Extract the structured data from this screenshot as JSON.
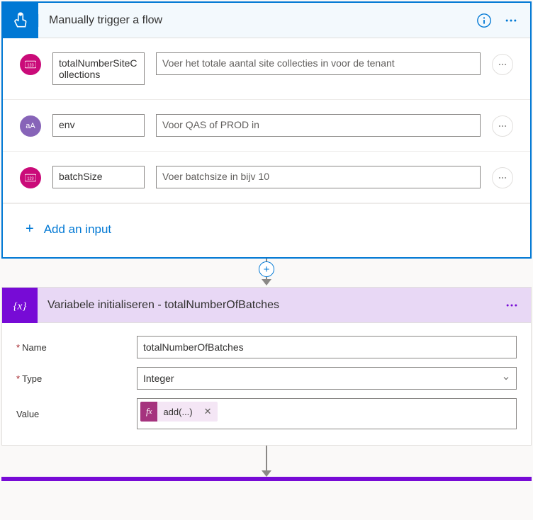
{
  "trigger": {
    "title": "Manually trigger a flow",
    "inputs": [
      {
        "type": "number",
        "name": "totalNumberSiteCollections",
        "desc": "Voer het totale aantal site collecties in voor de tenant"
      },
      {
        "type": "text",
        "name": "env",
        "desc": "Voor QAS of PROD in"
      },
      {
        "type": "number",
        "name": "batchSize",
        "desc": "Voer batchsize in bijv 10"
      }
    ],
    "addInputLabel": "Add an input"
  },
  "variable": {
    "title": "Variabele initialiseren - totalNumberOfBatches",
    "labels": {
      "name": "Name",
      "type": "Type",
      "value": "Value"
    },
    "name": "totalNumberOfBatches",
    "type": "Integer",
    "valueExpr": "add(...)"
  }
}
